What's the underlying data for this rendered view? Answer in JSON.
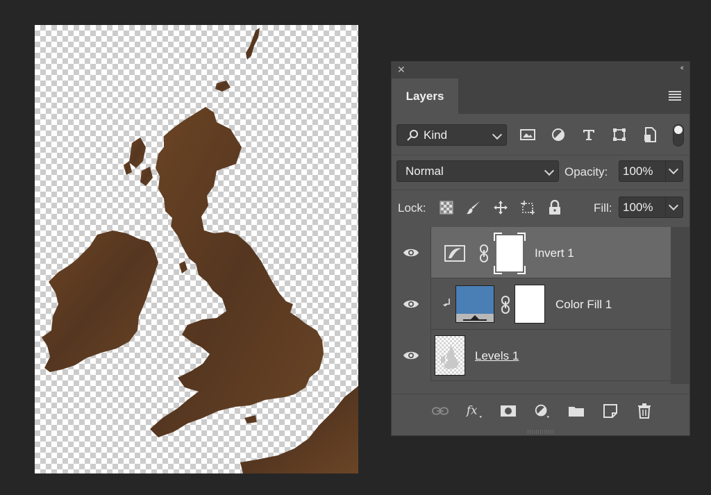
{
  "panel": {
    "close_glyph": "✕",
    "collapse_glyph": "‹‹",
    "tab_label": "Layers",
    "menu_icon": "panel-menu-icon"
  },
  "filter": {
    "kind_label": "Kind",
    "icons": [
      "pixel-layer-filter-icon",
      "adjustment-layer-filter-icon",
      "type-layer-filter-icon",
      "shape-layer-filter-icon",
      "smart-object-filter-icon"
    ]
  },
  "blend": {
    "mode": "Normal",
    "opacity_label": "Opacity:",
    "opacity_value": "100%"
  },
  "lock": {
    "label": "Lock:",
    "fill_label": "Fill:",
    "fill_value": "100%",
    "icons": [
      "lock-transparent-pixels-icon",
      "lock-image-pixels-icon",
      "lock-position-icon",
      "prevent-auto-nesting-icon",
      "lock-all-icon"
    ]
  },
  "layers": [
    {
      "name": "Invert 1",
      "type": "adjustment",
      "selected": true
    },
    {
      "name": "Color Fill 1",
      "type": "fill",
      "clipped": true,
      "fill_color": "#4a7fb5"
    },
    {
      "name": "Levels 1",
      "type": "levels"
    }
  ],
  "bottom_icons": [
    "link-layers-icon",
    "fx-icon",
    "add-mask-icon",
    "new-adjustment-icon",
    "new-group-icon",
    "new-layer-icon",
    "delete-layer-icon"
  ],
  "colors": {
    "map_brown": "#5a3a1e",
    "fill_blue": "#4a7fb5"
  }
}
